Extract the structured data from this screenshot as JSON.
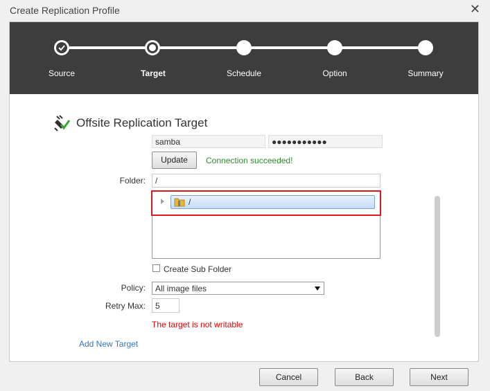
{
  "window": {
    "title": "Create Replication Profile",
    "close_glyph": "✕"
  },
  "wizard": {
    "steps": [
      {
        "label": "Source",
        "state": "done"
      },
      {
        "label": "Target",
        "state": "current"
      },
      {
        "label": "Schedule",
        "state": "pending"
      },
      {
        "label": "Option",
        "state": "pending"
      },
      {
        "label": "Summary",
        "state": "pending"
      }
    ]
  },
  "section": {
    "title": "Offsite Replication Target",
    "icon": "plug-check-icon"
  },
  "credentials": {
    "username": "samba",
    "password": "●●●●●●●●●●●"
  },
  "update_button": "Update",
  "connection_status": "Connection succeeded!",
  "folder": {
    "label": "Folder:",
    "value": "/",
    "tree": [
      {
        "label": "/",
        "icon": "folder-icon",
        "selected": true
      }
    ]
  },
  "create_sub_folder": {
    "label": "Create Sub Folder",
    "checked": false
  },
  "policy": {
    "label": "Policy:",
    "value": "All image files"
  },
  "retry_max": {
    "label": "Retry Max:",
    "value": "5"
  },
  "error_message": "The target is not writable",
  "add_target_link": "Add New Target",
  "footer": {
    "cancel": "Cancel",
    "back": "Back",
    "next": "Next"
  },
  "colors": {
    "header_bg": "#3d3d3d",
    "success": "#2e8b2e",
    "error": "#e00000",
    "link": "#2f79c2",
    "highlight": "#e0161e"
  }
}
